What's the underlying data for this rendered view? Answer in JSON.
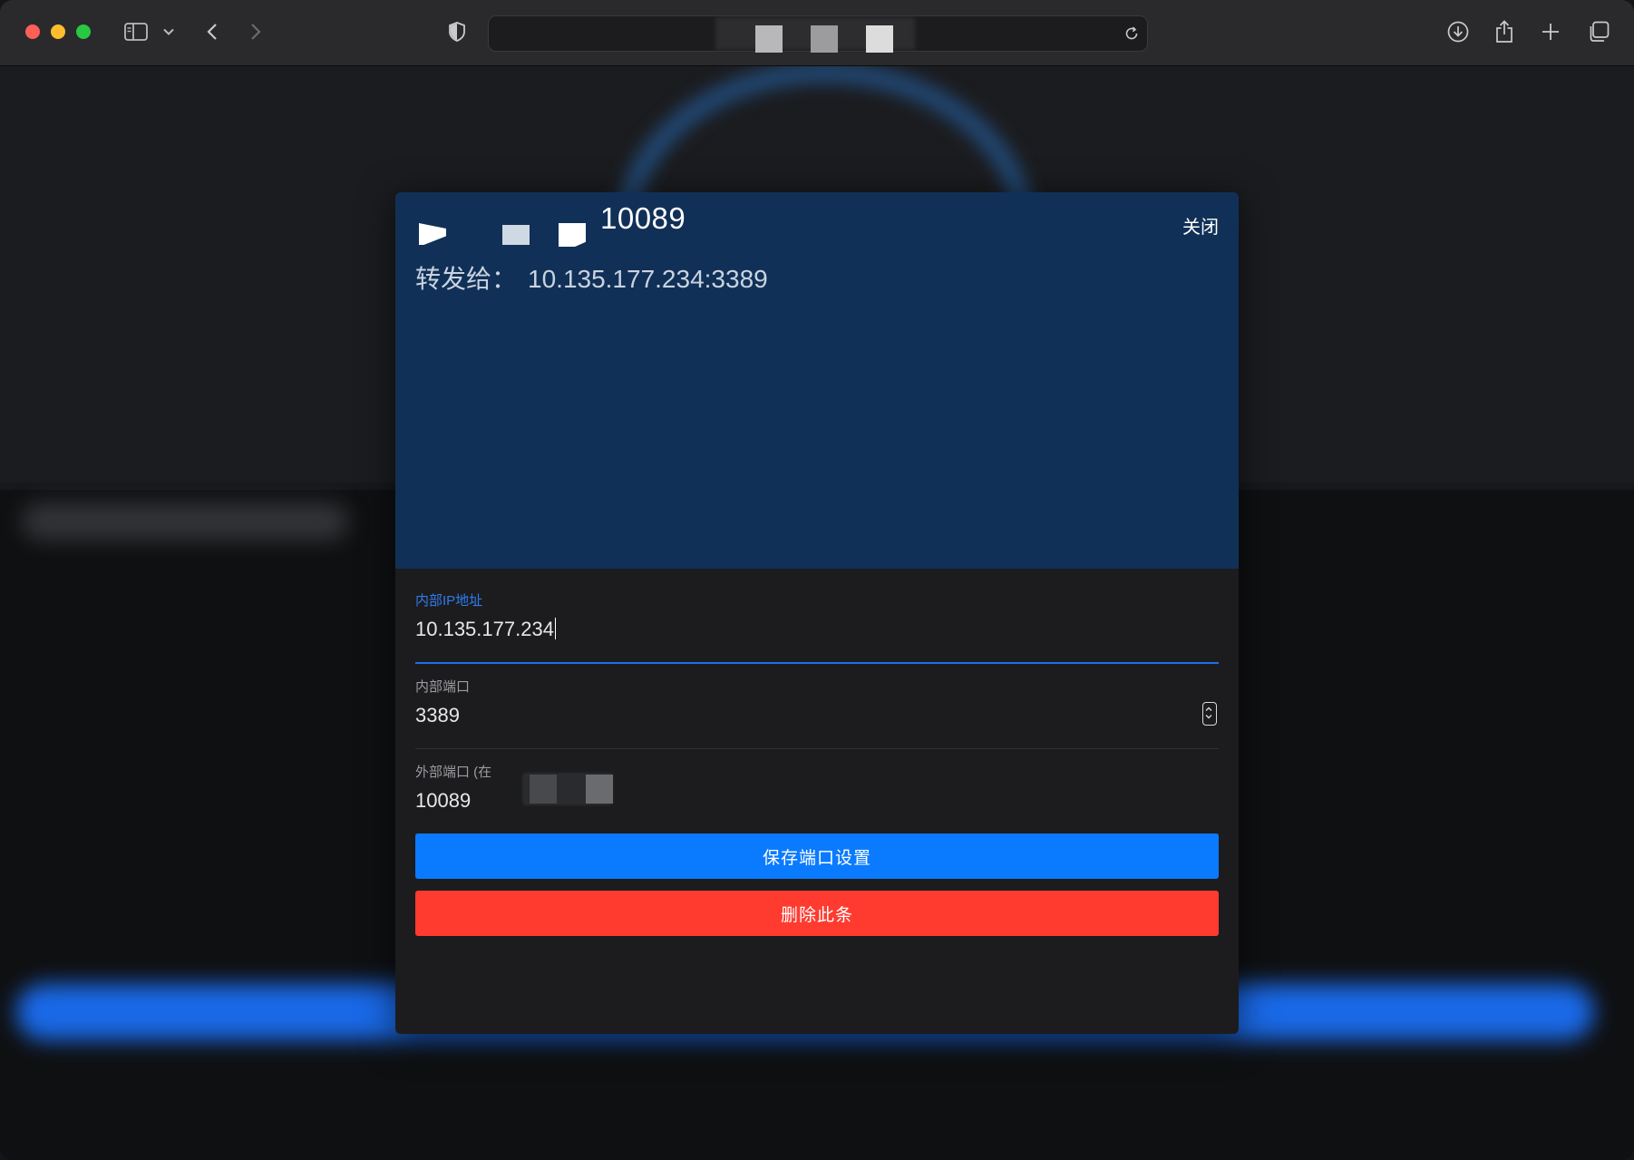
{
  "browser": {
    "icons": {
      "sidebar": "sidebar-icon",
      "chevron": "chevron-down-icon",
      "back": "back-arrow-icon",
      "forward": "forward-arrow-icon",
      "shield": "privacy-shield-icon",
      "reload": "reload-icon",
      "download": "download-icon",
      "share": "share-icon",
      "new_tab": "plus-icon",
      "tabs": "tab-overview-icon"
    }
  },
  "modal": {
    "title_number": "10089",
    "close_label": "关闭",
    "forward_label": "转发给：",
    "forward_target": "10.135.177.234:3389",
    "fields": [
      {
        "label": "内部IP地址",
        "value": "10.135.177.234"
      },
      {
        "label": "内部端口",
        "value": "3389"
      },
      {
        "label": "外部端口 (在",
        "value": "10089"
      }
    ],
    "save_label": "保存端口设置",
    "delete_label": "删除此条"
  },
  "colors": {
    "header_bg": "#113057",
    "accent_blue": "#0a7bff",
    "danger_red": "#ff3b30",
    "active_field_line": "#1a6ff0"
  }
}
